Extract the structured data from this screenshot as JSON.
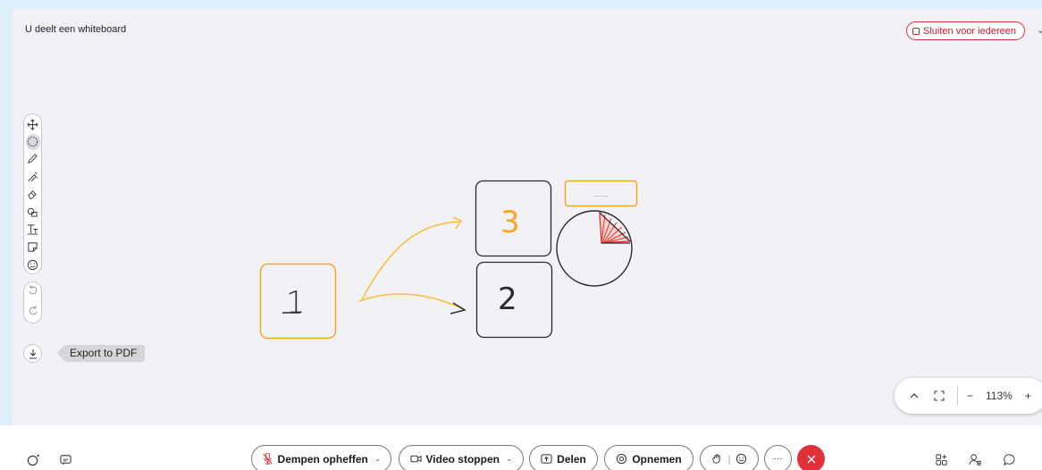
{
  "header": {
    "share_title": "U deelt een whiteboard",
    "close_all_label": "Sluiten voor iedereen",
    "close_all_extra": "⌄"
  },
  "toolbar": {
    "tools": [
      "move-icon",
      "lasso-icon",
      "pen-icon",
      "highlighter-icon",
      "eraser-icon",
      "shapes-icon",
      "text-icon",
      "sticky-note-icon",
      "emoji-icon"
    ],
    "active_tool": "lasso-icon",
    "undo_icon": "undo-icon",
    "redo_icon": "redo-icon"
  },
  "export": {
    "tooltip": "Export to PDF",
    "icon": "download-icon"
  },
  "canvas": {
    "box1_label": "1",
    "box2_label": "2",
    "box3_label": "3",
    "note_text": "........",
    "colors": {
      "orange": "#f5a623",
      "dark": "#2a2a2a",
      "red": "#e8302a"
    }
  },
  "zoom": {
    "value": "113%",
    "minus": "−",
    "plus": "+"
  },
  "bottom": {
    "unmute_label": "Dempen opheffen",
    "video_label": "Video stoppen",
    "share_label": "Delen",
    "record_label": "Opnemen",
    "more_label": "···"
  },
  "colors": {
    "accent_red": "#e0303a",
    "stage_bg": "#f2f2f6",
    "frame_bg": "#dceefa"
  }
}
